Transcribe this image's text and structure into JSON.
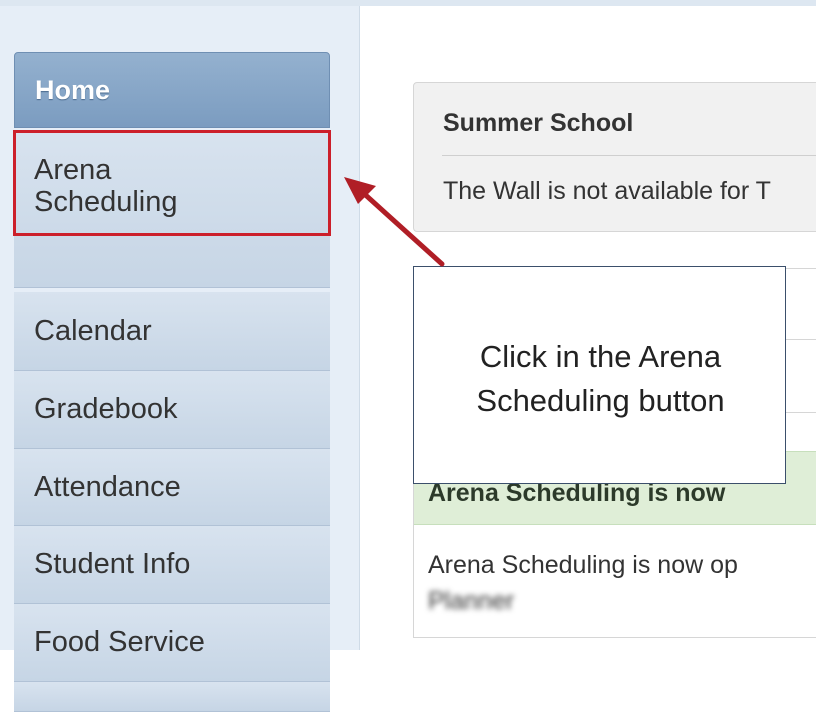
{
  "sidebar": {
    "items": [
      {
        "label": "Home",
        "active": true
      },
      {
        "label_line1": "Arena",
        "label_line2": "Scheduling"
      },
      {
        "label": "Calendar"
      },
      {
        "label": "Gradebook"
      },
      {
        "label": "Attendance"
      },
      {
        "label": "Student Info"
      },
      {
        "label": "Food Service"
      }
    ]
  },
  "main": {
    "summer_panel": {
      "title": "Summer School",
      "text": "The Wall is not available for T"
    },
    "arena_panel": {
      "header": "Arena Scheduling is now",
      "body": "Arena Scheduling is now op",
      "blurred": "Planner"
    }
  },
  "callout": {
    "text": "Click in the Arena Scheduling button"
  },
  "colors": {
    "highlight": "#cc1f2a",
    "home_bg": "#7b9cc0",
    "nav_bg": "#d2deeb",
    "green_header": "#dfeed7"
  }
}
